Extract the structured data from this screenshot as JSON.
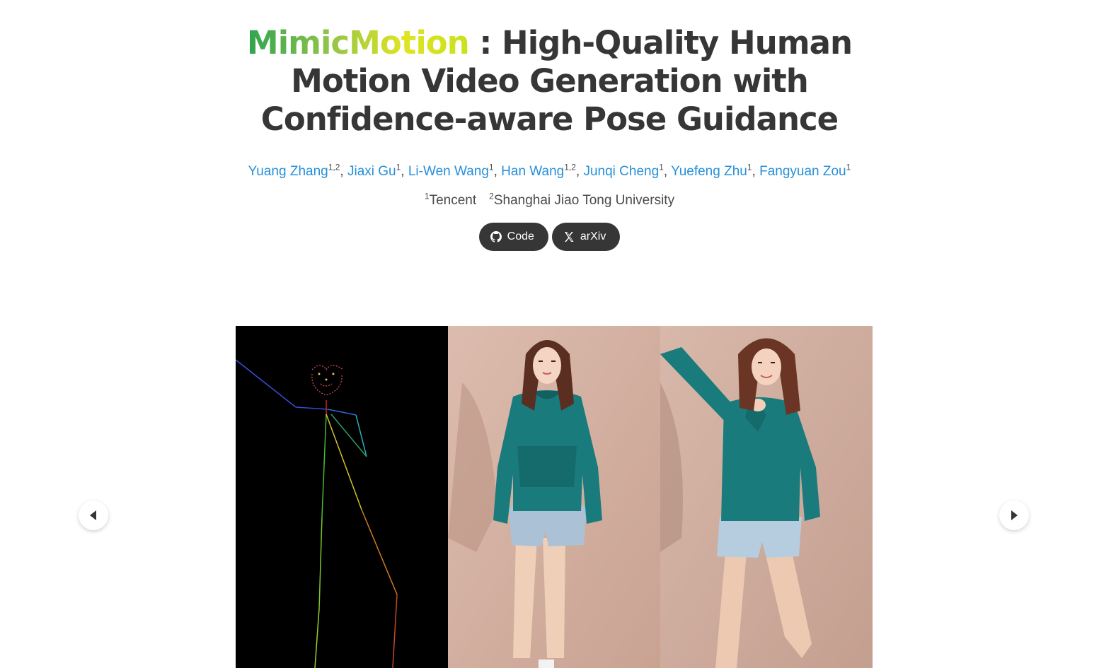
{
  "title": {
    "brand": "MimicMotion",
    "rest": " : High-Quality Human Motion Video Generation with Confidence-aware Pose Guidance"
  },
  "authors": [
    {
      "name": "Yuang Zhang",
      "sup": "1,2",
      "sep": ", "
    },
    {
      "name": "Jiaxi Gu",
      "sup": "1",
      "sep": ", "
    },
    {
      "name": "Li-Wen Wang",
      "sup": "1",
      "sep": ", "
    },
    {
      "name": "Han Wang",
      "sup": "1,2",
      "sep": ", "
    },
    {
      "name": "Junqi Cheng",
      "sup": "1",
      "sep": ", "
    },
    {
      "name": "Yuefeng Zhu",
      "sup": "1",
      "sep": ", "
    },
    {
      "name": "Fangyuan Zou",
      "sup": "1",
      "sep": ""
    }
  ],
  "affiliations": [
    {
      "sup": "1",
      "name": "Tencent"
    },
    {
      "sup": "2",
      "name": "Shanghai Jiao Tong University"
    }
  ],
  "links": {
    "code_label": "Code",
    "arxiv_label": "arXiv"
  },
  "colors": {
    "link": "#2790d9",
    "pill_bg": "#363636",
    "skin_bg": "#d9b6a6",
    "hoodie": "#1a7b7c"
  },
  "icons": {
    "code": "github-icon",
    "arxiv": "x-logo-icon",
    "prev": "caret-left-icon",
    "next": "caret-right-icon"
  }
}
